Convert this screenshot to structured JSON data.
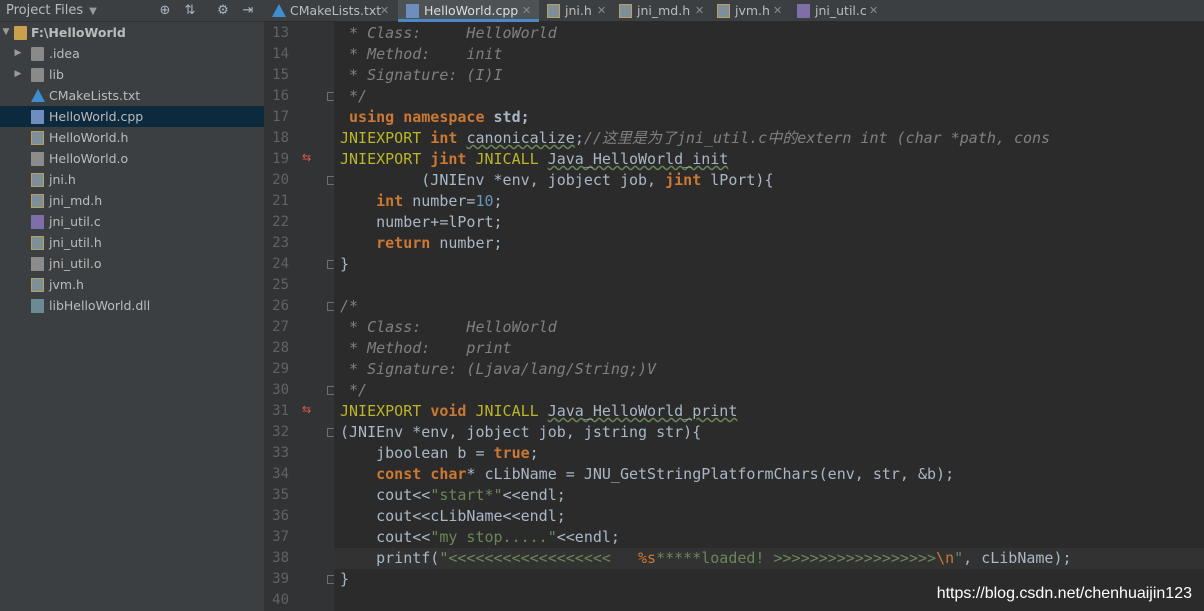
{
  "sidebar": {
    "title": "Project Files",
    "buttons": [
      "target-icon",
      "collapse-icon",
      "gear-icon",
      "hide-icon"
    ],
    "tree": [
      {
        "label": "F:\\HelloWorld",
        "icon": "folder-icon",
        "expanded": true,
        "bold": true
      },
      {
        "label": ".idea",
        "icon": "folder-icon",
        "expanded": false
      },
      {
        "label": "lib",
        "icon": "folder-icon",
        "expanded": false
      },
      {
        "label": "CMakeLists.txt",
        "icon": "cmake-icon"
      },
      {
        "label": "HelloWorld.cpp",
        "icon": "cpp-file-icon",
        "selected": true
      },
      {
        "label": "HelloWorld.h",
        "icon": "h-file-icon"
      },
      {
        "label": "HelloWorld.o",
        "icon": "o-file-icon"
      },
      {
        "label": "jni.h",
        "icon": "h-file-icon"
      },
      {
        "label": "jni_md.h",
        "icon": "h-file-icon"
      },
      {
        "label": "jni_util.c",
        "icon": "c-file-icon"
      },
      {
        "label": "jni_util.h",
        "icon": "h-file-icon"
      },
      {
        "label": "jni_util.o",
        "icon": "o-file-icon"
      },
      {
        "label": "jvm.h",
        "icon": "h-file-icon"
      },
      {
        "label": "libHelloWorld.dll",
        "icon": "dll-file-icon"
      }
    ]
  },
  "tabs": [
    {
      "label": "CMakeLists.txt",
      "icon": "cmake-icon"
    },
    {
      "label": "HelloWorld.cpp",
      "icon": "cpp-file-icon",
      "active": true
    },
    {
      "label": "jni.h",
      "icon": "h-file-icon"
    },
    {
      "label": "jni_md.h",
      "icon": "h-file-icon"
    },
    {
      "label": "jvm.h",
      "icon": "h-file-icon"
    },
    {
      "label": "jni_util.c",
      "icon": "c-file-icon"
    }
  ],
  "editor": {
    "line_numbers": [
      "13",
      "14",
      "15",
      "16",
      "17",
      "18",
      "19",
      "20",
      "21",
      "22",
      "23",
      "24",
      "25",
      "26",
      "27",
      "28",
      "29",
      "30",
      "31",
      "32",
      "33",
      "34",
      "35",
      "36",
      "37",
      "38",
      "39",
      "40"
    ],
    "lines": [
      " * Class:     HelloWorld",
      " * Method:    init",
      " * Signature: (I)I",
      " */",
      " using namespace std;",
      "JNIEXPORT int canonicalize;//这里是为了jni_util.c中的extern int (char *path, cons",
      "JNIEXPORT jint JNICALL Java_HelloWorld_init",
      "         (JNIEnv *env, jobject job, jint lPort){",
      "    int number=10;",
      "    number+=lPort;",
      "    return number;",
      "}",
      "",
      "/*",
      " * Class:     HelloWorld",
      " * Method:    print",
      " * Signature: (Ljava/lang/String;)V",
      " */",
      "JNIEXPORT void JNICALL Java_HelloWorld_print",
      "(JNIEnv *env, jobject job, jstring str){",
      "    jboolean b = true;",
      "    const char* cLibName = JNU_GetStringPlatformChars(env, str, &b);",
      "    cout<<\"start*\"<<endl;",
      "    cout<<cLibName<<endl;",
      "    cout<<\"my stop.....\"<<endl;",
      "    printf(\"<<<<<<<<<<<<<<<<<<   %s*****loaded! >>>>>>>>>>>>>>>>>>\\n\", cLibName);",
      "}",
      ""
    ]
  },
  "watermark": "https://blog.csdn.net/chenhuaijin123"
}
